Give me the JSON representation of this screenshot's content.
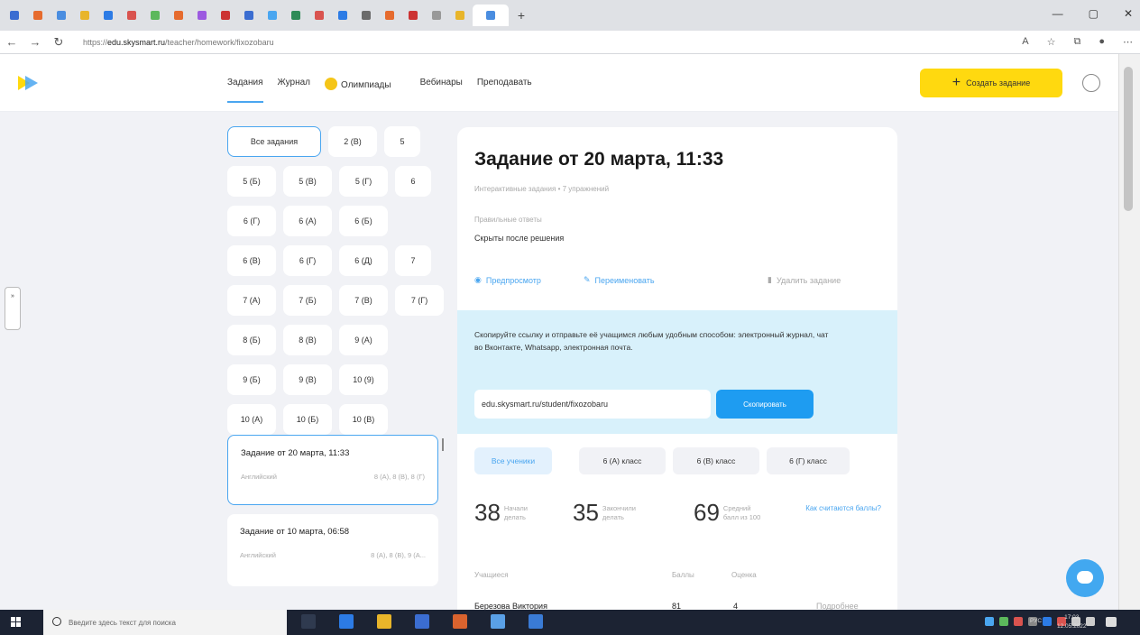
{
  "browser": {
    "url_prefix": "https://",
    "url_host": "edu.skysmart.ru",
    "url_path": "/teacher/homework/fixozobaru",
    "tab_colors": [
      "#3b6dd1",
      "#e66b2e",
      "#4a8de0",
      "#e8b52a",
      "#2c7be5",
      "#d9534f",
      "#5cb85c",
      "#e66b2e",
      "#9c5ae0",
      "#cc3333",
      "#3b6dd1",
      "#4aa6f0",
      "#2e8b57",
      "#d9534f",
      "#2c7be5",
      "#6b6b6b",
      "#e66b2e",
      "#cc3333",
      "#999999",
      "#e8b52a",
      "#4a8de0"
    ],
    "window_controls": [
      "—",
      "▢",
      "✕"
    ],
    "tab_add": "+"
  },
  "header": {
    "nav": [
      {
        "label": "Задания",
        "active": true
      },
      {
        "label": "Журнал",
        "active": false
      },
      {
        "label": "Олимпиады",
        "active": false
      },
      {
        "label": "Вебинары",
        "active": false
      },
      {
        "label": "Преподавать",
        "active": false
      }
    ],
    "create_button": "Создать задание",
    "create_icon": "plus-icon"
  },
  "side_handle_label": "»",
  "classes": [
    {
      "label": "Все задания",
      "selected": true
    },
    {
      "label": "2 (В)"
    },
    {
      "label": "5"
    },
    {
      "label": "5 (Б)"
    },
    {
      "label": "5 (В)"
    },
    {
      "label": "5 (Г)"
    },
    {
      "label": "6"
    },
    {
      "label": "6 (Г)"
    },
    {
      "label": "6 (А)"
    },
    {
      "label": "6 (Б)"
    },
    {
      "label": "6 (В)"
    },
    {
      "label": "6 (Г)"
    },
    {
      "label": "6 (Д)"
    },
    {
      "label": "7"
    },
    {
      "label": "7 (А)"
    },
    {
      "label": "7 (Б)"
    },
    {
      "label": "7 (В)"
    },
    {
      "label": "7 (Г)"
    },
    {
      "label": "8 (Б)"
    },
    {
      "label": "8 (В)"
    },
    {
      "label": "9 (А)"
    },
    {
      "label": "9 (Б)"
    },
    {
      "label": "9 (В)"
    },
    {
      "label": "10 (9)"
    },
    {
      "label": "10 (А)"
    },
    {
      "label": "10 (Б)"
    },
    {
      "label": "10 (В)"
    }
  ],
  "assignments": [
    {
      "title": "Задание от 20 марта, 11:33",
      "subject": "Английский",
      "classes": "8 (А), 8 (В), 8 (Г)",
      "selected": true
    },
    {
      "title": "Задание от 10 марта, 06:58",
      "subject": "Английский",
      "classes": "8 (А), 8 (В), 9 (А..."
    }
  ],
  "detail": {
    "title": "Задание от 20 марта, 11:33",
    "subtitle": "Интерактивные задания • 7 упражнений",
    "answers_label": "Правильные ответы",
    "answers_value": "Скрыты после решения",
    "preview": "Предпросмотр",
    "rename": "Переименовать",
    "delete": "Удалить задание",
    "share_text": "Скопируйте ссылку и отправьте её учащимся любым удобным способом: электронный журнал, чат во Вконтакте, Whatsapp, электронная почта.",
    "link": "edu.skysmart.ru/student/fixozobaru",
    "copy_button": "Скопировать",
    "filters": [
      {
        "label": "Все ученики",
        "active": true
      },
      {
        "label": "6 (А) класс"
      },
      {
        "label": "6 (В) класс"
      },
      {
        "label": "6 (Г) класс"
      }
    ],
    "stats": [
      {
        "value": "38",
        "label_line1": "Начали",
        "label_line2": "делать"
      },
      {
        "value": "35",
        "label_line1": "Закончили",
        "label_line2": "делать"
      },
      {
        "value": "69",
        "label_line1": "Средний",
        "label_line2": "балл из 100"
      }
    ],
    "how_link": "Как считаются баллы?",
    "table_headers": [
      "Учащиеся",
      "Баллы",
      "Оценка"
    ],
    "first_row": {
      "name": "Березова Виктория",
      "score": "81",
      "grade": "4",
      "more": "Подробнее"
    }
  },
  "taskbar": {
    "search_placeholder": "Введите здесь текст для поиска",
    "lang": "РУС",
    "time": "17:03",
    "date": "12.05.2022"
  },
  "colors": {
    "accent": "#4aa6f0",
    "brand_yellow": "#ffd90f",
    "share_bg": "#d8f1fb"
  }
}
